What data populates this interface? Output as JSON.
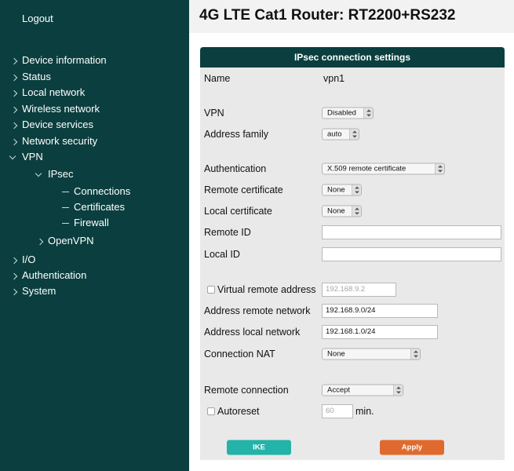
{
  "sidebar": {
    "logout": "Logout",
    "nav": [
      {
        "label": "Device information"
      },
      {
        "label": "Status"
      },
      {
        "label": "Local network"
      },
      {
        "label": "Wireless network"
      },
      {
        "label": "Device services"
      },
      {
        "label": "Network security"
      },
      {
        "label": "VPN"
      },
      {
        "label": "IPsec"
      },
      {
        "label": "Connections"
      },
      {
        "label": "Certificates"
      },
      {
        "label": "Firewall"
      },
      {
        "label": "OpenVPN"
      },
      {
        "label": "I/O"
      },
      {
        "label": "Authentication"
      },
      {
        "label": "System"
      }
    ]
  },
  "header": {
    "title": "4G LTE Cat1 Router: RT2200+RS232"
  },
  "panel": {
    "title": "IPsec connection settings",
    "name": {
      "label": "Name",
      "value": "vpn1"
    },
    "vpn": {
      "label": "VPN",
      "value": "Disabled"
    },
    "address_family": {
      "label": "Address family",
      "value": "auto"
    },
    "authentication": {
      "label": "Authentication",
      "value": "X.509 remote certificate"
    },
    "remote_certificate": {
      "label": "Remote certificate",
      "value": "None"
    },
    "local_certificate": {
      "label": "Local certificate",
      "value": "None"
    },
    "remote_id": {
      "label": "Remote ID",
      "value": ""
    },
    "local_id": {
      "label": "Local ID",
      "value": ""
    },
    "virtual_remote_address": {
      "label": "Virtual remote address",
      "placeholder": "192.168.9.2",
      "checked": false
    },
    "address_remote_network": {
      "label": "Address remote network",
      "value": "192.168.9.0/24"
    },
    "address_local_network": {
      "label": "Address local network",
      "value": "192.168.1.0/24"
    },
    "connection_nat": {
      "label": "Connection NAT",
      "value": "None"
    },
    "remote_connection": {
      "label": "Remote connection",
      "value": "Accept"
    },
    "autoreset": {
      "label": "Autoreset",
      "placeholder": "60",
      "unit": "min.",
      "checked": false
    },
    "ike_button": "IKE",
    "apply_button": "Apply"
  },
  "colors": {
    "sidebar_bg": "#0b3f3f",
    "panel_head_bg": "#0b3f3f",
    "ike_button": "#23b3a8",
    "apply_button": "#e06a2d"
  }
}
